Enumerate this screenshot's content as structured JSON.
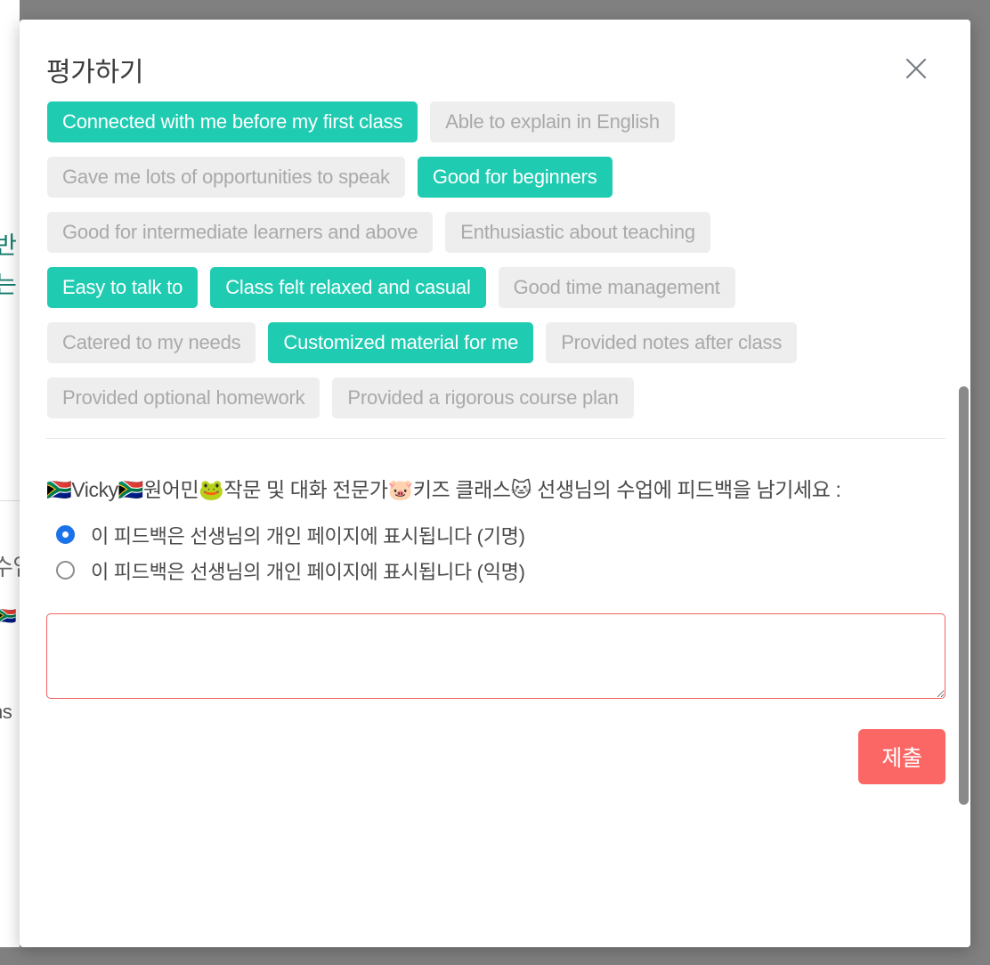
{
  "overlay": {
    "color": "#808080"
  },
  "background_page": {
    "fragment_1": "반",
    "fragment_2": "는",
    "fragment_3": "수업",
    "fragment_4": "ns",
    "flag": "🇿🇦"
  },
  "modal": {
    "title": "평가하기",
    "close_icon": "close-icon",
    "colors": {
      "selected_chip": "#1fcbb1",
      "unselected_chip": "#eeeeee",
      "unselected_chip_text": "#a9a9a9",
      "submit_button": "#fb6765",
      "textarea_border": "#f4615f",
      "radio_selected": "#1a73e8"
    },
    "chip_rows": [
      [
        {
          "label": "Connected with me before my first class",
          "selected": true
        },
        {
          "label": "Able to explain in English",
          "selected": false
        }
      ],
      [
        {
          "label": "Gave me lots of opportunities to speak",
          "selected": false
        },
        {
          "label": "Good for beginners",
          "selected": true
        }
      ],
      [
        {
          "label": "Good for intermediate learners and above",
          "selected": false
        },
        {
          "label": "Enthusiastic about teaching",
          "selected": false
        }
      ],
      [
        {
          "label": "Easy to talk to",
          "selected": true
        },
        {
          "label": "Class felt relaxed and casual",
          "selected": true
        },
        {
          "label": "Good time management",
          "selected": false
        }
      ],
      [
        {
          "label": "Catered to my needs",
          "selected": false
        },
        {
          "label": "Customized material for me",
          "selected": true
        },
        {
          "label": "Provided notes after class",
          "selected": false
        }
      ],
      [
        {
          "label": "Provided optional homework",
          "selected": false
        },
        {
          "label": "Provided a rigorous course plan",
          "selected": false
        }
      ]
    ],
    "feedback": {
      "prompt": "🇿🇦Vicky🇿🇦원어민🐸작문 및 대화 전문가🐷키즈 클래스🐱 선생님의 수업에 피드백을 남기세요 :",
      "visibility_options": [
        {
          "label": "이 피드백은 선생님의 개인 페이지에 표시됩니다 (기명)",
          "selected": true
        },
        {
          "label": "이 피드백은 선생님의 개인 페이지에 표시됩니다 (익명)",
          "selected": false
        }
      ],
      "comment_value": "",
      "comment_placeholder": ""
    },
    "submit_label": "제출"
  }
}
